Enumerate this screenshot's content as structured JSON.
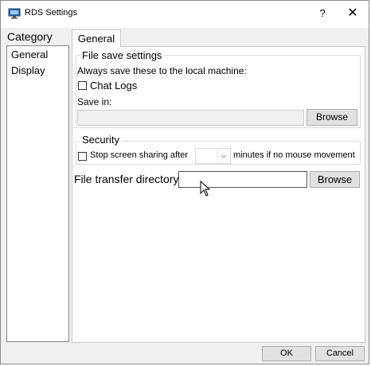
{
  "window": {
    "title": "RDS Settings",
    "help_glyph": "?",
    "close_glyph": "✕"
  },
  "sidebar": {
    "heading": "Category",
    "items": [
      {
        "label": "General"
      },
      {
        "label": "Display"
      }
    ]
  },
  "tabs": [
    {
      "label": "General",
      "selected": true
    }
  ],
  "file_save": {
    "legend": "File save settings",
    "description": "Always save these to the local machine:",
    "chat_logs_label": "Chat Logs",
    "chat_logs_checked": false,
    "save_in_label": "Save in:",
    "save_in_value": "",
    "browse_label": "Browse"
  },
  "security": {
    "legend": "Security",
    "stop_sharing_label": "Stop screen sharing after",
    "stop_sharing_checked": false,
    "minutes_value": "",
    "minutes_suffix": "minutes if no mouse movement"
  },
  "file_transfer": {
    "label": "File transfer directory",
    "value": "",
    "browse_label": "Browse"
  },
  "footer": {
    "ok_label": "OK",
    "cancel_label": "Cancel"
  },
  "colors": {
    "window_bg": "#f0f0f0",
    "panel_bg": "#ffffff",
    "button_bg": "#e1e1e1",
    "icon_blue": "#2b6cb0"
  }
}
